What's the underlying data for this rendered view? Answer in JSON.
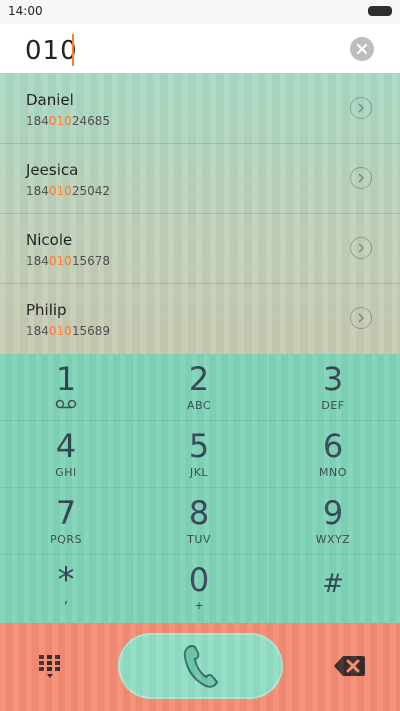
{
  "status": {
    "time": "14:00"
  },
  "search": {
    "value": "010"
  },
  "contacts": [
    {
      "name": "Daniel",
      "number_prefix": "184",
      "number_match": "010",
      "number_suffix": "24685"
    },
    {
      "name": "Jeesica",
      "number_prefix": "184",
      "number_match": "010",
      "number_suffix": "25042"
    },
    {
      "name": "Nicole",
      "number_prefix": "184",
      "number_match": "010",
      "number_suffix": "15678"
    },
    {
      "name": "Philip",
      "number_prefix": "184",
      "number_match": "010",
      "number_suffix": "15689"
    }
  ],
  "keypad": [
    {
      "digit": "1",
      "letters": ""
    },
    {
      "digit": "2",
      "letters": "ABC"
    },
    {
      "digit": "3",
      "letters": "DEF"
    },
    {
      "digit": "4",
      "letters": "GHI"
    },
    {
      "digit": "5",
      "letters": "JKL"
    },
    {
      "digit": "6",
      "letters": "MNO"
    },
    {
      "digit": "7",
      "letters": "PQRS"
    },
    {
      "digit": "8",
      "letters": "TUV"
    },
    {
      "digit": "9",
      "letters": "WXYZ"
    },
    {
      "digit": "*",
      "letters": ","
    },
    {
      "digit": "0",
      "letters": "+"
    },
    {
      "digit": "#",
      "letters": ""
    }
  ],
  "colors": {
    "highlight": "#ff7a2f",
    "keypad_bg": "#7fd3b8",
    "bottom_bg": "#f38b72",
    "call_button": "#90dcc2"
  },
  "icons": {
    "voicemail": "voicemail-icon",
    "clear": "clear-icon",
    "chevron": "chevron-right-icon",
    "dialpad": "dialpad-icon",
    "call": "phone-icon",
    "backspace": "backspace-icon"
  }
}
